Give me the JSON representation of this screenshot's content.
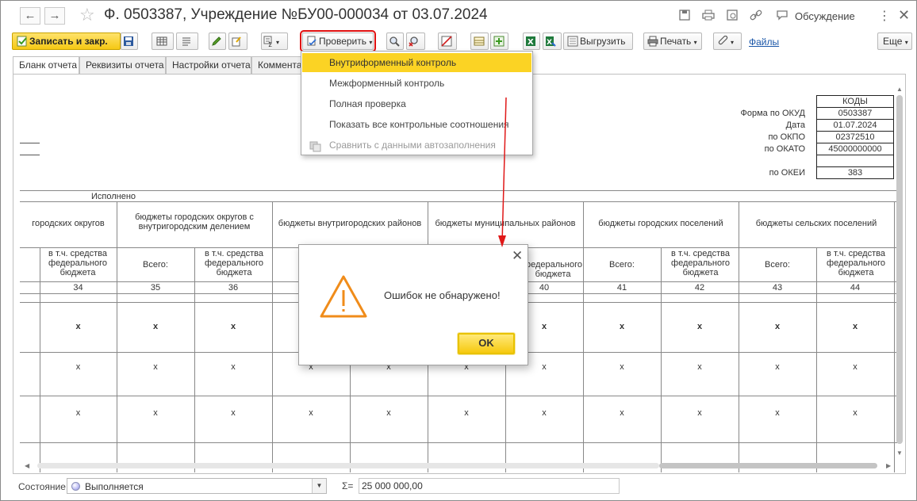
{
  "window": {
    "title": "Ф. 0503387, Учреждение №БУ00-000034 от 03.07.2024",
    "discussion_label": "Обсуждение"
  },
  "toolbar": {
    "save_close_label": "Записать и закр.",
    "check_label": "Проверить",
    "export_label": "Выгрузить",
    "print_label": "Печать",
    "files_link": "Файлы",
    "more_label": "Еще"
  },
  "tabs": [
    {
      "label": "Бланк отчета"
    },
    {
      "label": "Реквизиты отчета"
    },
    {
      "label": "Настройки отчета"
    },
    {
      "label": "Комментар"
    }
  ],
  "check_menu": {
    "items": [
      {
        "label": "Внутриформенный контроль"
      },
      {
        "label": "Межформенный контроль"
      },
      {
        "label": "Полная проверка"
      },
      {
        "label": "Показать все контрольные соотношения"
      },
      {
        "label": "Сравнить с данными автозаполнения"
      }
    ]
  },
  "codes": {
    "header": "КОДЫ",
    "labels": {
      "okud": "Форма по ОКУД",
      "date": "Дата",
      "okpo": "по ОКПО",
      "okato": "по ОКАТО",
      "okei": "по ОКЕИ"
    },
    "values": {
      "okud": "0503387",
      "date": "01.07.2024",
      "okpo": "02372510",
      "okato": "45000000000",
      "blank": "",
      "okei": "383"
    }
  },
  "report": {
    "executed_label": "Исполнено",
    "groups": [
      "городских округов",
      "бюджеты городских округов с внутригородским делением",
      "бюджеты внутригородских районов",
      "бюджеты муниципальных районов",
      "бюджеты городских поселений",
      "бюджеты сельских поселений"
    ],
    "sub_total": "Всего:",
    "sub_federal": "в т.ч. средства федерального бюджета",
    "sub_federal_partial": "федерального бюджета",
    "col_numbers": [
      "34",
      "35",
      "36",
      "40",
      "41",
      "42",
      "43",
      "44"
    ],
    "mark_bold": "x",
    "mark": "x"
  },
  "dialog": {
    "message": "Ошибок не обнаружено!",
    "ok_label": "OK"
  },
  "status": {
    "label": "Состояние:",
    "value": "Выполняется",
    "sum_label": "Σ=",
    "sum_value": "25 000 000,00"
  }
}
